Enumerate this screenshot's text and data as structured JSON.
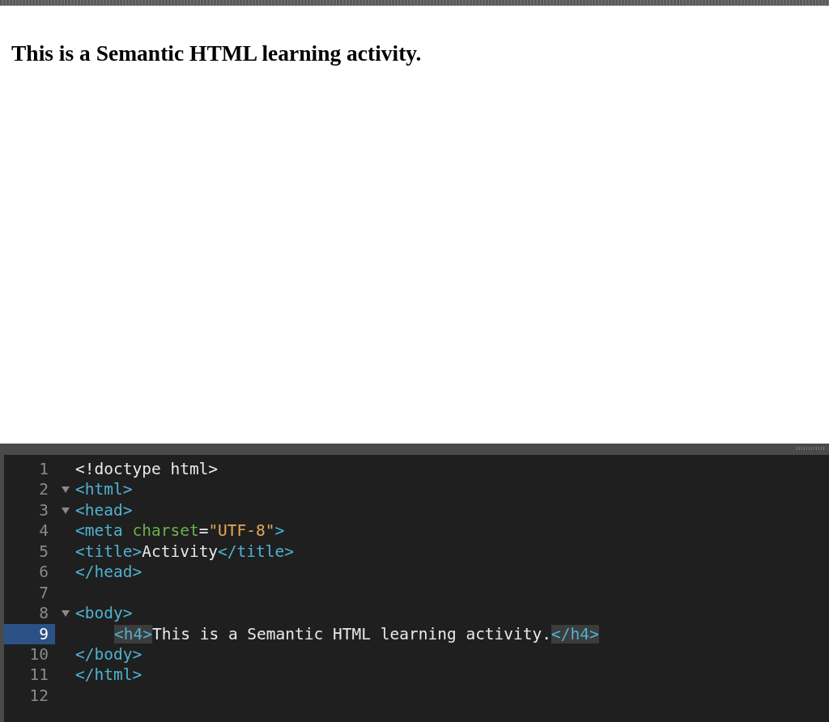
{
  "preview": {
    "heading": "This is a Semantic HTML learning activity."
  },
  "editor": {
    "lines": [
      {
        "number": "1",
        "foldable": false,
        "selected": false,
        "indented": false,
        "tokens": [
          {
            "kind": "text",
            "text": "<!doctype html>"
          }
        ]
      },
      {
        "number": "2",
        "foldable": true,
        "selected": false,
        "indented": false,
        "tokens": [
          {
            "kind": "tag",
            "text": "<html>"
          }
        ]
      },
      {
        "number": "3",
        "foldable": true,
        "selected": false,
        "indented": false,
        "tokens": [
          {
            "kind": "tag",
            "text": "<head>"
          }
        ]
      },
      {
        "number": "4",
        "foldable": false,
        "selected": false,
        "indented": false,
        "tokens": [
          {
            "kind": "tag",
            "text": "<meta"
          },
          {
            "kind": "attr",
            "text": " charset"
          },
          {
            "kind": "text",
            "text": "="
          },
          {
            "kind": "string",
            "text": "\"UTF-8\""
          },
          {
            "kind": "tag",
            "text": ">"
          }
        ]
      },
      {
        "number": "5",
        "foldable": false,
        "selected": false,
        "indented": false,
        "tokens": [
          {
            "kind": "tag",
            "text": "<title>"
          },
          {
            "kind": "text",
            "text": "Activity"
          },
          {
            "kind": "tag",
            "text": "</title>"
          }
        ]
      },
      {
        "number": "6",
        "foldable": false,
        "selected": false,
        "indented": false,
        "tokens": [
          {
            "kind": "tag",
            "text": "</head>"
          }
        ]
      },
      {
        "number": "7",
        "foldable": false,
        "selected": false
      },
      {
        "number": "8",
        "foldable": true,
        "selected": false,
        "indented": false,
        "tokens": [
          {
            "kind": "tag",
            "text": "<body>"
          }
        ]
      },
      {
        "number": "9",
        "foldable": false,
        "selected": true,
        "indented": true,
        "tokens": [
          {
            "kind": "matched-tag",
            "text": "<h4>"
          },
          {
            "kind": "text",
            "text": "This is a Semantic HTML learning activity."
          },
          {
            "kind": "matched-tag",
            "text": "</h4>"
          }
        ]
      },
      {
        "number": "10",
        "foldable": false,
        "selected": false,
        "indented": false,
        "tokens": [
          {
            "kind": "tag",
            "text": "</body>"
          }
        ]
      },
      {
        "number": "11",
        "foldable": false,
        "selected": false,
        "indented": false,
        "tokens": [
          {
            "kind": "tag",
            "text": "</html>"
          }
        ]
      },
      {
        "number": "12",
        "foldable": false,
        "selected": false
      }
    ]
  }
}
